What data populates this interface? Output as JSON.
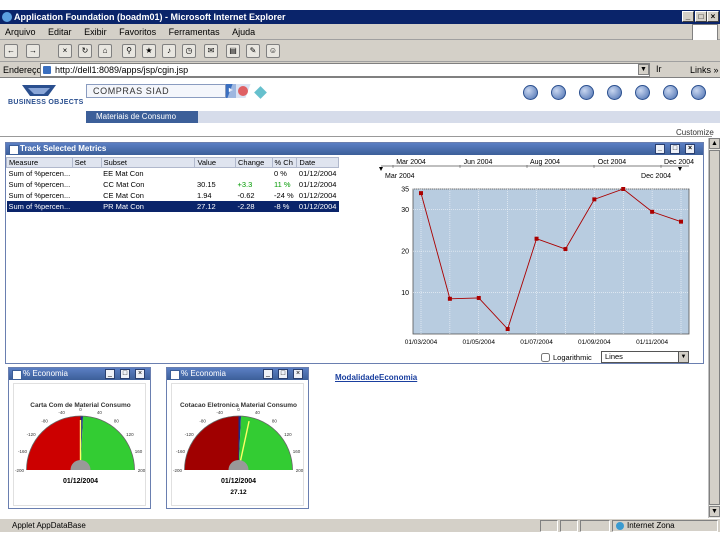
{
  "window": {
    "title": "Application Foundation (boadm01) - Microsoft Internet Explorer"
  },
  "menu": [
    "Arquivo",
    "Editar",
    "Exibir",
    "Favoritos",
    "Ferramentas",
    "Ajuda"
  ],
  "address": {
    "label": "Endereço",
    "url": "http://dell1:8089/apps/jsp/cgin.jsp",
    "go": "Ir",
    "links": "Links »"
  },
  "app": {
    "logo_text": "BUSINESS OBJECTS",
    "selector_value": "COMPRAS SIAD",
    "tab_label": "Materiais de Consumo",
    "customize": "Customize",
    "brand_color": "#3c5f99"
  },
  "track": {
    "title": "Track Selected Metrics",
    "columns": [
      "Measure",
      "Set",
      "Subset",
      "Value",
      "Change",
      "% Ch",
      "Date"
    ],
    "rows": [
      {
        "measure": "Sum of %percen...",
        "set": "",
        "subset": "EE Mat Con",
        "value": "",
        "change": "",
        "pct": "0 %",
        "date": "01/12/2004",
        "selected": false
      },
      {
        "measure": "Sum of %percen...",
        "set": "",
        "subset": "CC Mat Con",
        "value": "30.15",
        "change": "+3.3",
        "pct": "11 %",
        "date": "01/12/2004",
        "selected": false
      },
      {
        "measure": "Sum of %percen...",
        "set": "",
        "subset": "CE Mat Con",
        "value": "1.94",
        "change": "-0.62",
        "pct": "-24 %",
        "date": "01/12/2004",
        "selected": false
      },
      {
        "measure": "Sum of %percen...",
        "set": "",
        "subset": "PR Mat Con",
        "value": "27.12",
        "change": "-2.28",
        "pct": "-8 %",
        "date": "01/12/2004",
        "selected": true
      }
    ],
    "slider_months": [
      "Mar 2004",
      "Jun 2004",
      "Aug 2004",
      "Oct 2004",
      "Dec 2004"
    ],
    "range_start": "Mar 2004",
    "range_end": "Dec 2004",
    "logarithmic_label": "Logarithmic",
    "chart_type": "Lines"
  },
  "chart_data": {
    "type": "line",
    "x": [
      "01/03/2004",
      "01/04/2004",
      "01/05/2004",
      "01/06/2004",
      "01/07/2004",
      "01/08/2004",
      "01/09/2004",
      "01/10/2004",
      "01/11/2004",
      "01/12/2004"
    ],
    "xtick_labels": [
      "01/03/2004",
      "01/05/2004",
      "01/07/2004",
      "01/09/2004",
      "01/11/2004"
    ],
    "series": [
      {
        "values": [
          34,
          8.5,
          8.7,
          1.2,
          23,
          20.5,
          32.5,
          35,
          29.5,
          27.12
        ],
        "color": "#aa0000"
      }
    ],
    "ylim": [
      0,
      35
    ],
    "yticks": [
      10,
      20,
      30,
      35
    ],
    "grid": true,
    "background": "#b8cce0"
  },
  "gauges": [
    {
      "panel_title": "% Economia",
      "title": "Carta Com de Material Consumo",
      "date": "01/12/2004",
      "value_text": "",
      "needle_value": 0,
      "scale_labels": [
        "-200",
        "-160",
        "-120",
        "-80",
        "-40",
        "0",
        "40",
        "80",
        "120",
        "160",
        "200"
      ]
    },
    {
      "panel_title": "% Economia",
      "title": "Cotacao Eletronica Material Consumo",
      "date": "01/12/2004",
      "value_text": "27.12",
      "needle_value": 27.12,
      "scale_labels": [
        "-200",
        "-160",
        "-120",
        "-80",
        "-40",
        "0",
        "40",
        "80",
        "120",
        "160",
        "200"
      ]
    }
  ],
  "link": {
    "modalidade": "ModalidadeEconomia"
  },
  "status": {
    "text": "Applet AppDataBase",
    "zone": "Internet Zona"
  }
}
